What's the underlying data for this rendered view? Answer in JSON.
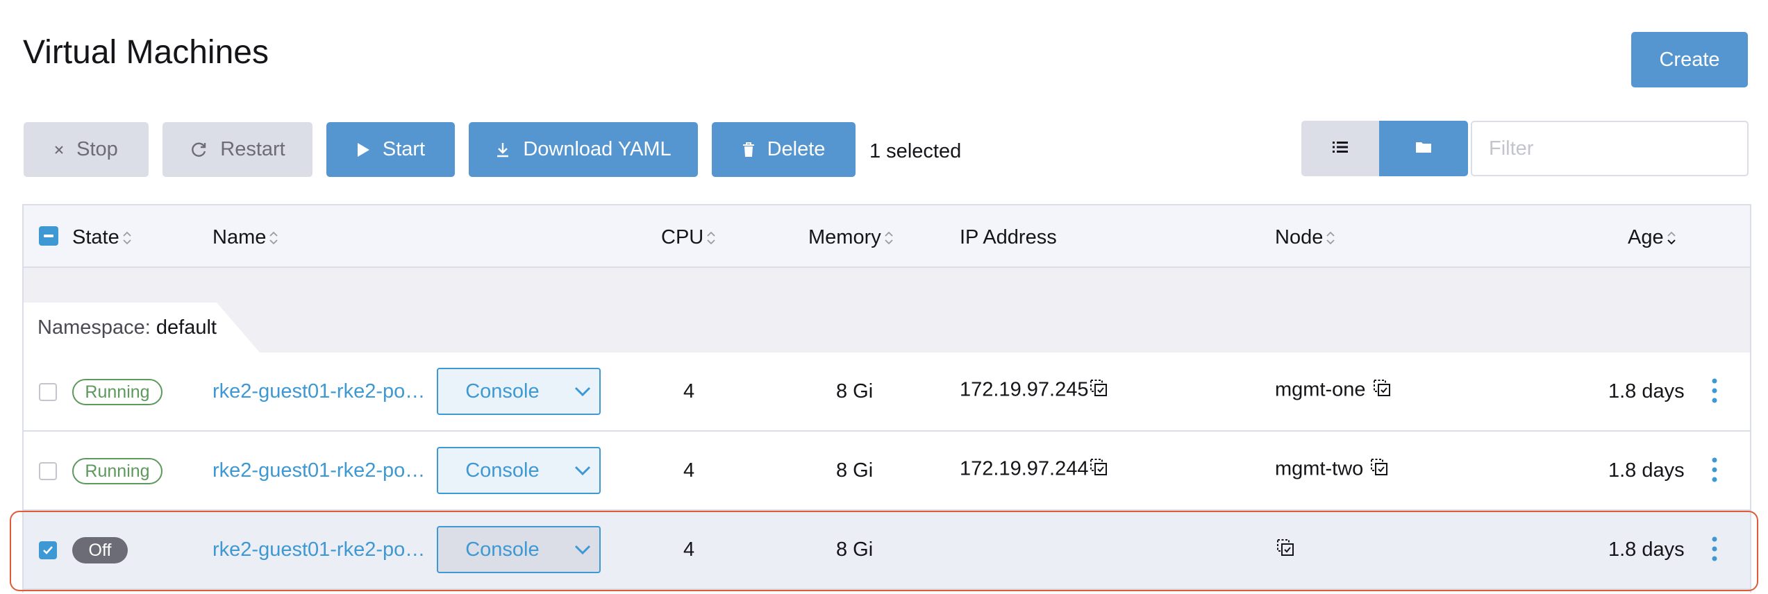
{
  "page": {
    "title": "Virtual Machines"
  },
  "header": {
    "create_label": "Create"
  },
  "toolbar": {
    "stop_label": "Stop",
    "restart_label": "Restart",
    "start_label": "Start",
    "download_label": "Download YAML",
    "delete_label": "Delete",
    "selected_text": "1 selected",
    "filter_placeholder": "Filter",
    "filter_value": ""
  },
  "table": {
    "columns": {
      "state": "State",
      "name": "Name",
      "cpu": "CPU",
      "memory": "Memory",
      "ip": "IP Address",
      "node": "Node",
      "age": "Age"
    },
    "group": {
      "key": "Namespace:",
      "value": "default"
    },
    "rows": [
      {
        "state": "Running",
        "name": "rke2-guest01-rke2-pool...",
        "console": "Console",
        "cpu": "4",
        "memory": "8 Gi",
        "ip": "172.19.97.245",
        "node": "mgmt-one",
        "age": "1.8 days",
        "checked": false
      },
      {
        "state": "Running",
        "name": "rke2-guest01-rke2-pool...",
        "console": "Console",
        "cpu": "4",
        "memory": "8 Gi",
        "ip": "172.19.97.244",
        "node": "mgmt-two",
        "age": "1.8 days",
        "checked": false
      },
      {
        "state": "Off",
        "name": "rke2-guest01-rke2-pool...",
        "console": "Console",
        "cpu": "4",
        "memory": "8 Gi",
        "ip": "",
        "node": "",
        "age": "1.8 days",
        "checked": true
      }
    ]
  },
  "colors": {
    "primary": "#5696d0",
    "link": "#3d98d3",
    "running": "#5d995d",
    "off": "#6c6c76",
    "highlight": "#e05a3a"
  }
}
